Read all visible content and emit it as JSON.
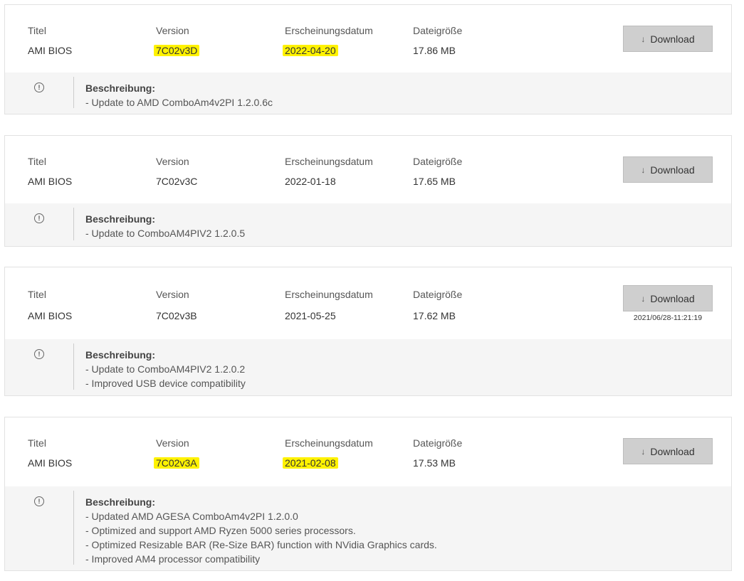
{
  "headers": {
    "title": "Titel",
    "version": "Version",
    "date": "Erscheinungsdatum",
    "size": "Dateigröße"
  },
  "download_label": "Download",
  "description_label": "Beschreibung:",
  "entries": [
    {
      "title": "AMI BIOS",
      "version": "7C02v3D",
      "date": "2022-04-20",
      "size": "17.86 MB",
      "highlighted": true,
      "description": [
        "- Update to AMD ComboAm4v2PI 1.2.0.6c"
      ]
    },
    {
      "title": "AMI BIOS",
      "version": "7C02v3C",
      "date": "2022-01-18",
      "size": "17.65 MB",
      "highlighted": false,
      "description": [
        "- Update to ComboAM4PIV2 1.2.0.5"
      ]
    },
    {
      "title": "AMI BIOS",
      "version": "7C02v3B",
      "date": "2021-05-25",
      "size": "17.62 MB",
      "highlighted": false,
      "download_timestamp": "2021/06/28-11:21:19",
      "description": [
        "- Update to ComboAM4PIV2 1.2.0.2",
        "- Improved USB device compatibility"
      ]
    },
    {
      "title": "AMI BIOS",
      "version": "7C02v3A",
      "date": "2021-02-08",
      "size": "17.53 MB",
      "highlighted": true,
      "description": [
        "- Updated AMD AGESA ComboAm4v2PI 1.2.0.0",
        "- Optimized and support AMD Ryzen 5000 series processors.",
        "- Optimized Resizable BAR (Re-Size BAR) function with NVidia Graphics cards.",
        "- Improved AM4 processor compatibility"
      ]
    }
  ],
  "colors": {
    "highlight": "#fff200",
    "button_bg": "#cfcfcf",
    "description_bg": "#f5f5f5",
    "border": "#e2e2e2"
  }
}
